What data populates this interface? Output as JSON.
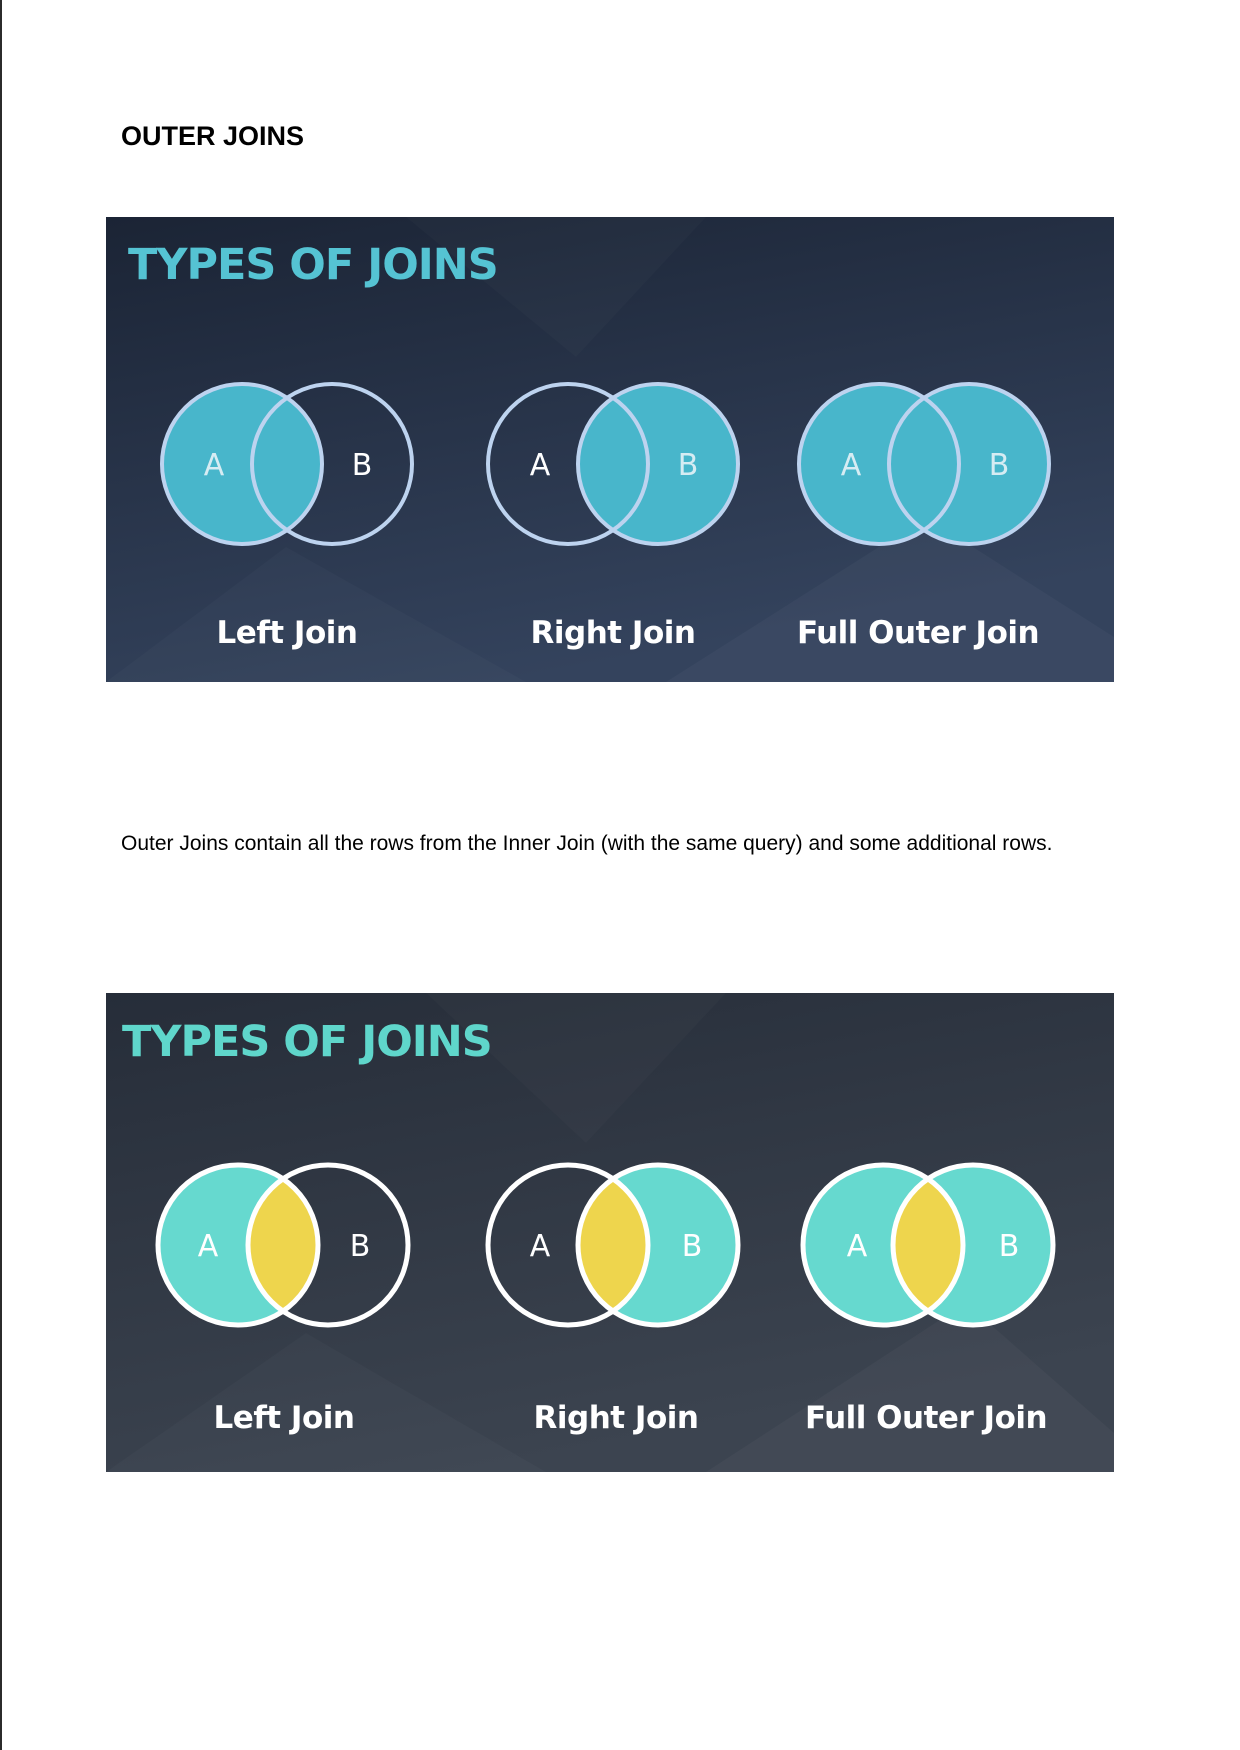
{
  "heading": "OUTER JOINS",
  "paragraph": "Outer Joins contain all the rows from the Inner Join (with the same query) and some additional rows.",
  "slides": [
    {
      "title": "TYPES OF JOINS",
      "colors": {
        "bg_top": "#1b2435",
        "bg_bottom": "#34435d",
        "title": "#55c3d3",
        "fill": "#48b6cb",
        "overlap": "#48b6cb",
        "outline": "#bdd3ef",
        "letter_on_fill": "#d6ecf3",
        "letter_on_dark": "#ffffff",
        "label": "#ffffff"
      },
      "diagrams": [
        {
          "label": "Left Join",
          "a": "A",
          "b": "B",
          "fill_a": true,
          "fill_b": false
        },
        {
          "label": "Right Join",
          "a": "A",
          "b": "B",
          "fill_a": false,
          "fill_b": true
        },
        {
          "label": "Full Outer Join",
          "a": "A",
          "b": "B",
          "fill_a": true,
          "fill_b": true
        }
      ]
    },
    {
      "title": "TYPES OF JOINS",
      "colors": {
        "bg_top": "#262d39",
        "bg_bottom": "#3c4450",
        "title": "#5fd6cb",
        "fill": "#66d9cf",
        "overlap": "#eed54d",
        "outline": "#ffffff",
        "letter_on_fill": "#ffffff",
        "letter_on_dark": "#ffffff",
        "label": "#ffffff"
      },
      "diagrams": [
        {
          "label": "Left Join",
          "a": "A",
          "b": "B",
          "fill_a": true,
          "fill_b": false
        },
        {
          "label": "Right Join",
          "a": "A",
          "b": "B",
          "fill_a": false,
          "fill_b": true
        },
        {
          "label": "Full Outer Join",
          "a": "A",
          "b": "B",
          "fill_a": true,
          "fill_b": true
        }
      ]
    }
  ]
}
